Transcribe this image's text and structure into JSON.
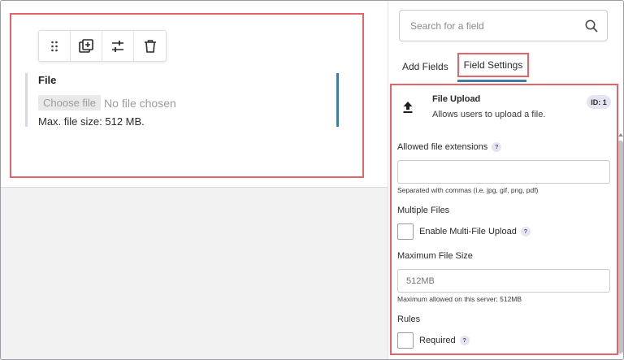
{
  "canvas": {
    "toolbar": {
      "drag": "drag-handle-icon",
      "duplicate": "duplicate-icon",
      "settings": "settings-sliders-icon",
      "delete": "trash-icon"
    },
    "field": {
      "label": "File",
      "choose_button": "Choose file",
      "no_file_text": "No file chosen",
      "max_size_text": "Max. file size: 512 MB."
    }
  },
  "sidebar": {
    "search": {
      "placeholder": "Search for a field",
      "icon": "search-icon"
    },
    "tabs": [
      {
        "label": "Add Fields",
        "active": false
      },
      {
        "label": "Field Settings",
        "active": true
      }
    ],
    "field_type": {
      "title": "File Upload",
      "description": "Allows users to upload a file.",
      "id_badge": "ID: 1",
      "icon": "upload-icon"
    },
    "allowed_extensions": {
      "label": "Allowed file extensions",
      "help": "?",
      "value": "",
      "hint": "Separated with commas (i.e. jpg, gif, png, pdf)"
    },
    "multiple_files": {
      "heading": "Multiple Files",
      "checkbox_label": "Enable Multi-File Upload",
      "help": "?",
      "checked": false
    },
    "max_file_size": {
      "label": "Maximum File Size",
      "placeholder": "512MB",
      "hint": "Maximum allowed on this server: 512MB"
    },
    "rules": {
      "heading": "Rules",
      "checkbox_label": "Required",
      "help": "?",
      "checked": false
    }
  },
  "colors": {
    "highlight": "#e4646a",
    "accent": "#3e7da6",
    "field_left_bar": "#d7d7ec",
    "badge_bg": "#e3e5f1"
  }
}
